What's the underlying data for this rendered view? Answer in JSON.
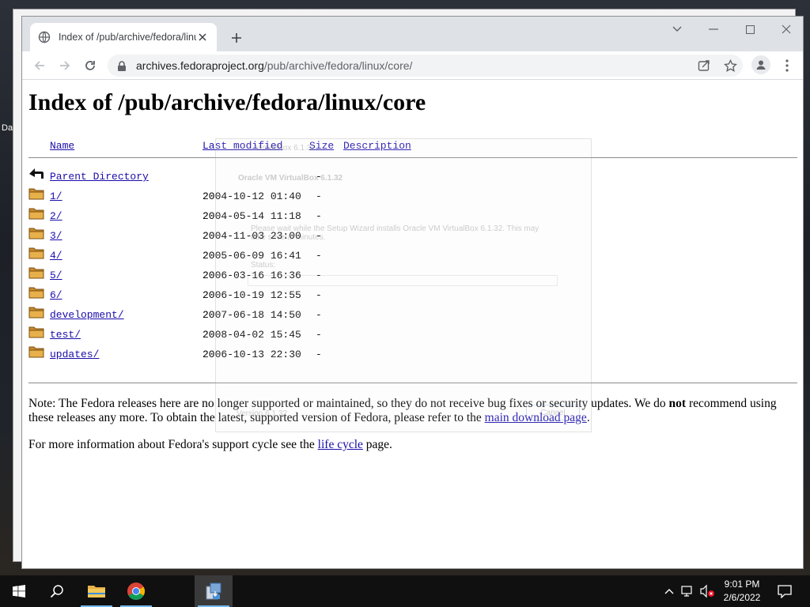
{
  "desktop": {
    "icon_label": "Da"
  },
  "browser": {
    "tab": {
      "title": "Index of /pub/archive/fedora/linu"
    },
    "url": {
      "host": "archives.fedoraproject.org",
      "path": "/pub/archive/fedora/linux/core/"
    }
  },
  "page": {
    "title": "Index of /pub/archive/fedora/linux/core",
    "columns": {
      "name": "Name",
      "modified": "Last modified",
      "size": "Size",
      "description": "Description"
    },
    "parent": {
      "name": "Parent Directory",
      "size": "-"
    },
    "entries": [
      {
        "name": "1/",
        "modified": "2004-10-12 01:40",
        "size": "-"
      },
      {
        "name": "2/",
        "modified": "2004-05-14 11:18",
        "size": "-"
      },
      {
        "name": "3/",
        "modified": "2004-11-03 23:00",
        "size": "-"
      },
      {
        "name": "4/",
        "modified": "2005-06-09 16:41",
        "size": "-"
      },
      {
        "name": "5/",
        "modified": "2006-03-16 16:36",
        "size": "-"
      },
      {
        "name": "6/",
        "modified": "2006-10-19 12:55",
        "size": "-"
      },
      {
        "name": "development/",
        "modified": "2007-06-18 14:50",
        "size": "-"
      },
      {
        "name": "test/",
        "modified": "2008-04-02 15:45",
        "size": "-"
      },
      {
        "name": "updates/",
        "modified": "2006-10-13 22:30",
        "size": "-"
      }
    ],
    "note1": {
      "prefix": "Note: The Fedora releases here are no longer supported or maintained, so they do not receive bug fixes or security updates. We do ",
      "bold": "not",
      "middle": " recommend using these releases any more. To obtain the latest, supported version of Fedora, please refer to the ",
      "link": "main download page",
      "suffix": "."
    },
    "note2": {
      "prefix": "For more information about Fedora's support cycle see the ",
      "link": "life cycle",
      "suffix": " page."
    }
  },
  "installer_overlay": {
    "window_title": "VirtualBox 6.1.32",
    "heading": "Oracle VM VirtualBox 6.1.32",
    "message": "Please wait while the Setup Wizard installs Oracle VM VirtualBox 6.1.32. This may take several minutes.",
    "status_label": "Status:",
    "version": "Version 6.1.32",
    "cancel": "Cancel"
  },
  "taskbar": {
    "time": "9:01 PM",
    "date": "2/6/2022"
  },
  "colors": {
    "link": "#1a0dab",
    "folder": "#e8b04a",
    "taskbar": "#101010"
  }
}
